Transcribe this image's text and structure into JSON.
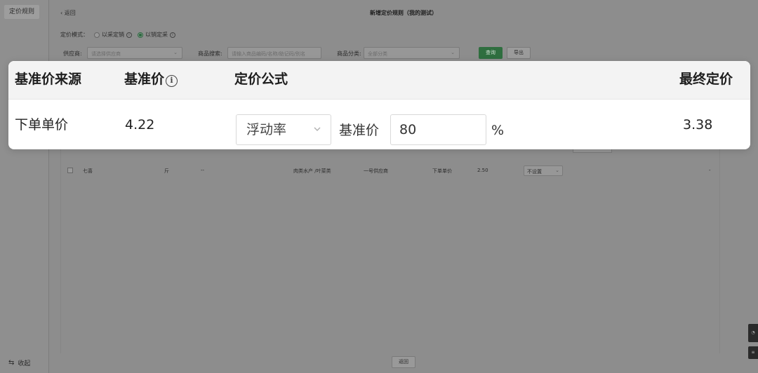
{
  "sidebar": {
    "active_item": "定价规则",
    "collapse_label": "收起"
  },
  "header": {
    "back_label": "返回",
    "title": "新增定价规则（我的测试）"
  },
  "pricing_mode": {
    "label": "定价模式：",
    "options": [
      {
        "label": "以采定销",
        "selected": false
      },
      {
        "label": "以销定采",
        "selected": true
      }
    ]
  },
  "filters": {
    "supplier_label": "供应商:",
    "supplier_placeholder": "请选择供应商",
    "search_label": "商品搜索:",
    "search_placeholder": "请输入商品编码/名称/助记码/别名",
    "category_label": "商品分类:",
    "category_value": "全部分类",
    "query_button": "查询",
    "export_button": "导出"
  },
  "background_row": {
    "name": "七喜",
    "unit": "斤",
    "spec": "--",
    "category": "肉类水产 /叶菜类",
    "supplier": "一号供应商",
    "source": "下单单价",
    "price": "2.50",
    "setting": "不设置",
    "final": "-"
  },
  "footer": {
    "return_button": "返回"
  },
  "card": {
    "headers": {
      "source": "基准价来源",
      "base_price": "基准价",
      "formula": "定价公式",
      "final_price": "最终定价"
    },
    "row": {
      "source": "下单单价",
      "base_price": "4.22",
      "formula_type": "浮动率",
      "formula_label": "基准价",
      "rate_value": "80",
      "rate_unit": "%",
      "final_price": "3.38"
    }
  },
  "colors": {
    "accent_green": "#2f6e3f",
    "card_bg": "#ffffff",
    "card_header_bg": "#f3f3f3"
  }
}
